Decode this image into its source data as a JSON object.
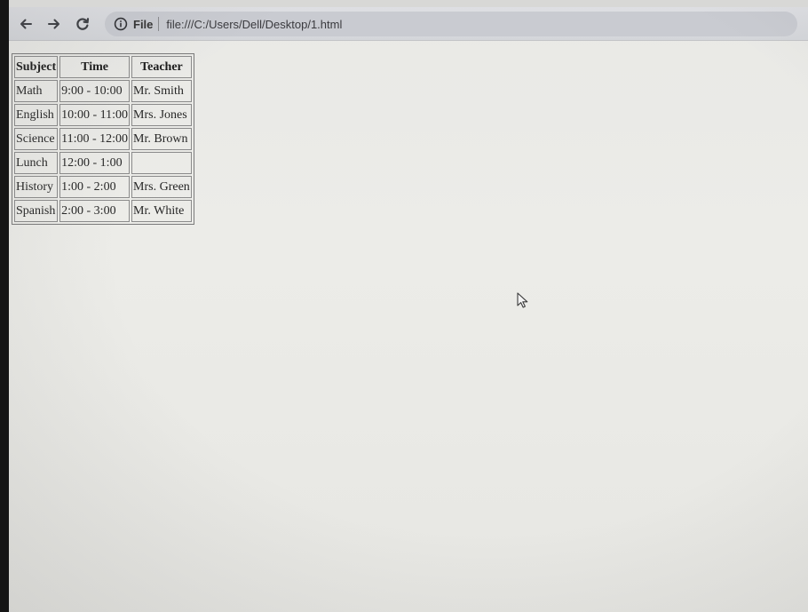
{
  "browser": {
    "back_icon": "arrow-left-icon",
    "forward_icon": "arrow-right-icon",
    "reload_icon": "reload-icon",
    "info_icon": "info-icon",
    "scheme_label": "File",
    "url": "file:///C:/Users/Dell/Desktop/1.html"
  },
  "schedule": {
    "headers": [
      "Subject",
      "Time",
      "Teacher"
    ],
    "rows": [
      {
        "subject": "Math",
        "time": "9:00 - 10:00",
        "teacher": "Mr. Smith"
      },
      {
        "subject": "English",
        "time": "10:00 - 11:00",
        "teacher": "Mrs. Jones"
      },
      {
        "subject": "Science",
        "time": "11:00 - 12:00",
        "teacher": "Mr. Brown"
      },
      {
        "subject": "Lunch",
        "time": "12:00 - 1:00",
        "teacher": ""
      },
      {
        "subject": "History",
        "time": "1:00 - 2:00",
        "teacher": "Mrs. Green"
      },
      {
        "subject": "Spanish",
        "time": "2:00 - 3:00",
        "teacher": "Mr. White"
      }
    ]
  },
  "cursor_icon": "mouse-pointer-icon",
  "colors": {
    "toolbar": "#d8d9dd",
    "omnibox": "#c9cbd1",
    "page_background": "#ebebe7",
    "bezel": "#151515"
  }
}
